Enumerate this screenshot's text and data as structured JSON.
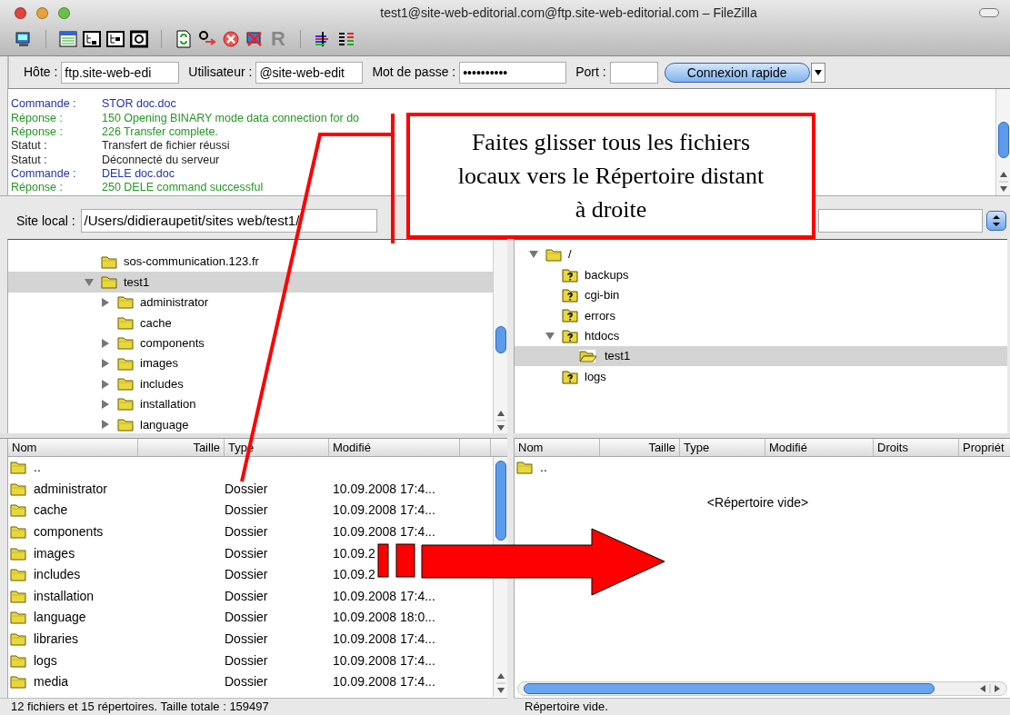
{
  "window": {
    "title": "test1@site-web-editorial.com@ftp.site-web-editorial.com – FileZilla"
  },
  "toolbar": {
    "reconnect_glyph": "R"
  },
  "quickconnect": {
    "fields": [
      {
        "label": "Hôte :",
        "value": "ftp.site-web-edi"
      },
      {
        "label": "Utilisateur :",
        "value": "@site-web-edit"
      },
      {
        "label": "Mot de passe :",
        "value": "••••••••••"
      },
      {
        "label": "Port :"
      }
    ],
    "button": "Connexion rapide"
  },
  "log": [
    {
      "kind": "command",
      "label": "Commande :",
      "message": "STOR doc.doc"
    },
    {
      "kind": "response",
      "label": "Réponse :",
      "message": "150 Opening BINARY mode data connection for do"
    },
    {
      "kind": "response",
      "label": "Réponse :",
      "message": "226 Transfer complete."
    },
    {
      "kind": "status",
      "label": "Statut :",
      "message": "Transfert de fichier réussi"
    },
    {
      "kind": "status",
      "label": "Statut :",
      "message": "Déconnecté du serveur"
    },
    {
      "kind": "command",
      "label": "Commande :",
      "message": "DELE doc.doc"
    },
    {
      "kind": "response",
      "label": "Réponse :",
      "message": "250 DELE command successful"
    }
  ],
  "local": {
    "site_label": "Site local :",
    "path": "/Users/didieraupetit/sites web/test1/",
    "tree": [
      {
        "name": "sos-communication.123.fr",
        "kind": "folder",
        "has_children": false,
        "selected": false
      },
      {
        "name": "test1",
        "kind": "folder",
        "has_children": true,
        "expanded": true,
        "selected": true,
        "children": [
          {
            "name": "administrator",
            "kind": "folder",
            "has_children": true,
            "expanded": false,
            "selected": false
          },
          {
            "name": "cache",
            "kind": "folder",
            "has_children": false,
            "selected": false
          },
          {
            "name": "components",
            "kind": "folder",
            "has_children": true,
            "expanded": false,
            "selected": false
          },
          {
            "name": "images",
            "kind": "folder",
            "has_children": true,
            "expanded": false,
            "selected": false
          },
          {
            "name": "includes",
            "kind": "folder",
            "has_children": true,
            "expanded": false,
            "selected": false
          },
          {
            "name": "installation",
            "kind": "folder",
            "has_children": true,
            "expanded": false,
            "selected": false
          },
          {
            "name": "language",
            "kind": "folder",
            "has_children": true,
            "expanded": false,
            "selected": false
          }
        ]
      }
    ],
    "columns": [
      "Nom",
      "Taille",
      "Type",
      "Modifié"
    ],
    "rows": [
      {
        "name": ".."
      },
      {
        "name": "administrator",
        "type": "Dossier",
        "modified": "10.09.2008 17:4..."
      },
      {
        "name": "cache",
        "type": "Dossier",
        "modified": "10.09.2008 17:4..."
      },
      {
        "name": "components",
        "type": "Dossier",
        "modified": "10.09.2008 17:4..."
      },
      {
        "name": "images",
        "type": "Dossier",
        "modified": "10.09.2"
      },
      {
        "name": "includes",
        "type": "Dossier",
        "modified": "10.09.2"
      },
      {
        "name": "installation",
        "type": "Dossier",
        "modified": "10.09.2008 17:4..."
      },
      {
        "name": "language",
        "type": "Dossier",
        "modified": "10.09.2008 18:0..."
      },
      {
        "name": "libraries",
        "type": "Dossier",
        "modified": "10.09.2008 17:4..."
      },
      {
        "name": "logs",
        "type": "Dossier",
        "modified": "10.09.2008 17:4..."
      },
      {
        "name": "media",
        "type": "Dossier",
        "modified": "10.09.2008 17:4..."
      }
    ],
    "status": "12 fichiers et 15 répertoires. Taille totale : 159497"
  },
  "remote": {
    "tree": [
      {
        "name": "/",
        "kind": "folder",
        "has_children": true,
        "expanded": true,
        "selected": false,
        "children": [
          {
            "name": "backups",
            "kind": "unknown",
            "has_children": false,
            "selected": false
          },
          {
            "name": "cgi-bin",
            "kind": "unknown",
            "has_children": false,
            "selected": false
          },
          {
            "name": "errors",
            "kind": "unknown",
            "has_children": false,
            "selected": false
          },
          {
            "name": "htdocs",
            "kind": "unknown",
            "has_children": true,
            "expanded": true,
            "selected": false,
            "children": [
              {
                "name": "test1",
                "kind": "open",
                "has_children": false,
                "selected": true
              }
            ]
          },
          {
            "name": "logs",
            "kind": "unknown",
            "has_children": false,
            "selected": false
          }
        ]
      }
    ],
    "columns": [
      "Nom",
      "Taille",
      "Type",
      "Modifié",
      "Droits",
      "Propriét"
    ],
    "rows": [
      {
        "name": ".."
      }
    ],
    "empty_message": "<Répertoire vide>",
    "status": "Répertoire vide."
  },
  "annotation": {
    "text": "Faites glisser tous les fichiers locaux vers le Répertoire distant à droite"
  }
}
